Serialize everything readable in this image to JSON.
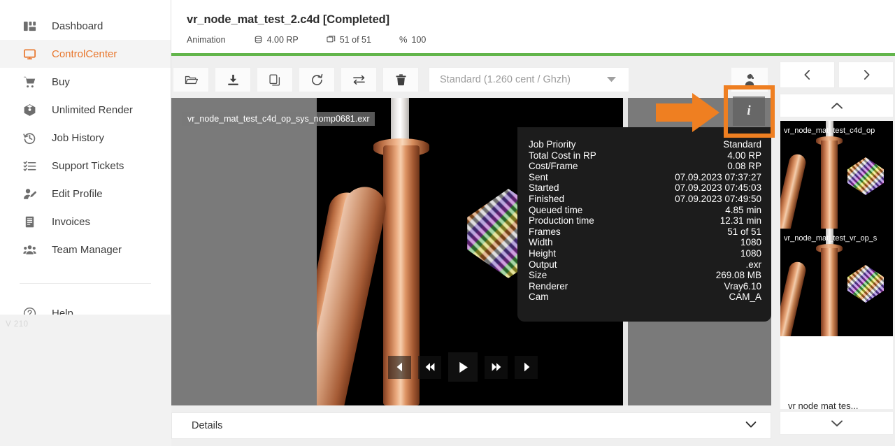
{
  "sidebar": {
    "items": [
      {
        "label": "Dashboard",
        "icon": "dashboard-icon",
        "active": false
      },
      {
        "label": "ControlCenter",
        "icon": "monitor-icon",
        "active": true
      },
      {
        "label": "Buy",
        "icon": "cart-icon",
        "active": false
      },
      {
        "label": "Unlimited Render",
        "icon": "box-icon",
        "active": false
      },
      {
        "label": "Job History",
        "icon": "history-icon",
        "active": false
      },
      {
        "label": "Support Tickets",
        "icon": "list-icon",
        "active": false
      },
      {
        "label": "Edit Profile",
        "icon": "user-edit-icon",
        "active": false
      },
      {
        "label": "Invoices",
        "icon": "invoice-icon",
        "active": false
      },
      {
        "label": "Team Manager",
        "icon": "team-icon",
        "active": false
      }
    ],
    "help_label": "Help",
    "version": "V 210"
  },
  "header": {
    "job_title": "vr_node_mat_test_2.c4d [Completed]",
    "type": "Animation",
    "cost": "4.00 RP",
    "frames": "51 of 51",
    "percent": "100",
    "percent_symbol": "%",
    "progress_color": "#62b54b",
    "collapse_icon": "collapse-panel-icon"
  },
  "toolbar": {
    "buttons": [
      {
        "name": "open-folder-button",
        "icon": "folder-icon"
      },
      {
        "name": "download-button",
        "icon": "download-icon"
      },
      {
        "name": "copy-button",
        "icon": "copy-icon"
      },
      {
        "name": "restart-button",
        "icon": "refresh-icon"
      },
      {
        "name": "transfer-button",
        "icon": "transfer-icon"
      },
      {
        "name": "delete-button",
        "icon": "trash-icon"
      }
    ],
    "priority_select": "Standard (1.260 cent / Ghzh)",
    "account_icon": "support-agent-icon"
  },
  "viewer": {
    "file_label": "vr_node_mat_test_c4d_op_sys_nomp0681.exr",
    "info_button_label": "i",
    "info_panel": [
      {
        "key": "Job Priority",
        "value": "Standard"
      },
      {
        "key": "Total Cost in RP",
        "value": "4.00 RP"
      },
      {
        "key": "Cost/Frame",
        "value": "0.08 RP"
      },
      {
        "key": "Sent",
        "value": "07.09.2023 07:37:27"
      },
      {
        "key": "Started",
        "value": "07.09.2023 07:45:03"
      },
      {
        "key": "Finished",
        "value": "07.09.2023 07:49:50"
      },
      {
        "key": "Queued time",
        "value": "4.85 min"
      },
      {
        "key": "Production time",
        "value": "12.31 min"
      },
      {
        "key": "Frames",
        "value": "51 of 51"
      },
      {
        "key": "Width",
        "value": "1080"
      },
      {
        "key": "Height",
        "value": "1080"
      },
      {
        "key": "Output",
        "value": ".exr"
      },
      {
        "key": "Size",
        "value": "269.08 MB"
      },
      {
        "key": "Renderer",
        "value": "Vray6.10"
      },
      {
        "key": "Cam",
        "value": "CAM_A"
      }
    ],
    "playback": [
      {
        "name": "step-back-button",
        "icon": "chevron-left-icon"
      },
      {
        "name": "rewind-button",
        "icon": "double-chevron-left-icon"
      },
      {
        "name": "play-button",
        "icon": "play-icon"
      },
      {
        "name": "forward-button",
        "icon": "double-chevron-right-icon"
      },
      {
        "name": "step-forward-button",
        "icon": "chevron-right-icon"
      }
    ]
  },
  "details": {
    "label": "Details",
    "caret_icon": "chevron-down-icon"
  },
  "right_panel": {
    "prev_icon": "chevron-left-icon",
    "next_icon": "chevron-right-icon",
    "scroll_up_icon": "chevron-up-icon",
    "scroll_down_icon": "chevron-down-icon",
    "thumbnails": [
      {
        "label": "vr_node_mat_test_c4d_op"
      },
      {
        "label": "vr_node_mat_test_vr_op_s"
      }
    ],
    "caption": "vr  node  mat  tes..."
  },
  "annotation": {
    "highlight_color": "#ef7f21",
    "arrow_icon": "right-arrow-annotation"
  }
}
